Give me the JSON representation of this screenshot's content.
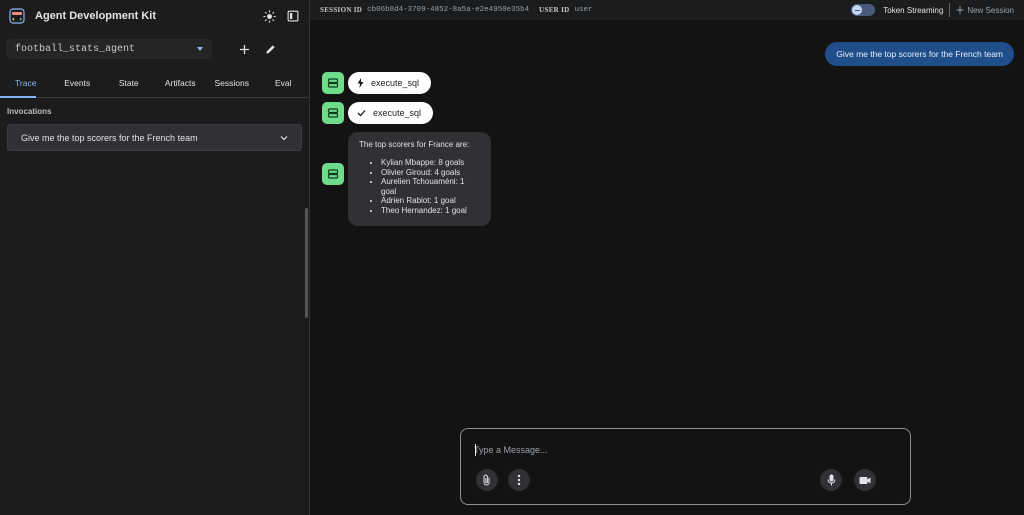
{
  "app": {
    "title": "Agent Development Kit"
  },
  "sidebar": {
    "agent_selected": "football_stats_agent",
    "tabs": [
      {
        "label": "Trace"
      },
      {
        "label": "Events"
      },
      {
        "label": "State"
      },
      {
        "label": "Artifacts"
      },
      {
        "label": "Sessions"
      },
      {
        "label": "Eval"
      }
    ],
    "active_tab": "Trace",
    "section_label": "Invocations",
    "invocations": [
      {
        "label": "Give me the top scorers for the French team"
      }
    ]
  },
  "topbar": {
    "session_id_label": "SESSION ID",
    "session_id": "cb06b8d4-3709-4852-8a5a-e2e4950e35b4",
    "user_id_label": "USER ID",
    "user_id": "user",
    "token_streaming_label": "Token Streaming",
    "new_session_label": "New Session"
  },
  "chat": {
    "user_message": "Give me the top scorers for the French team",
    "function_call": {
      "name": "execute_sql",
      "icon": "bolt-icon"
    },
    "function_response": {
      "name": "execute_sql",
      "icon": "check-icon"
    },
    "bot_reply": {
      "intro": "The top scorers for France are:",
      "items": [
        "Kylian Mbappe: 8 goals",
        "Olivier Giroud: 4 goals",
        "Aurelien Tchouaméni: 1 goal",
        "Adrien Rabiot: 1 goal",
        "Theo Hernandez: 1 goal"
      ]
    }
  },
  "composer": {
    "placeholder": "Type a Message..."
  },
  "colors": {
    "accent": "#8ab4f8",
    "user_bubble": "#1f4e8a",
    "bot_avatar": "#6fdc8c",
    "background": "#131314",
    "sidebar": "#1b1c1d"
  }
}
